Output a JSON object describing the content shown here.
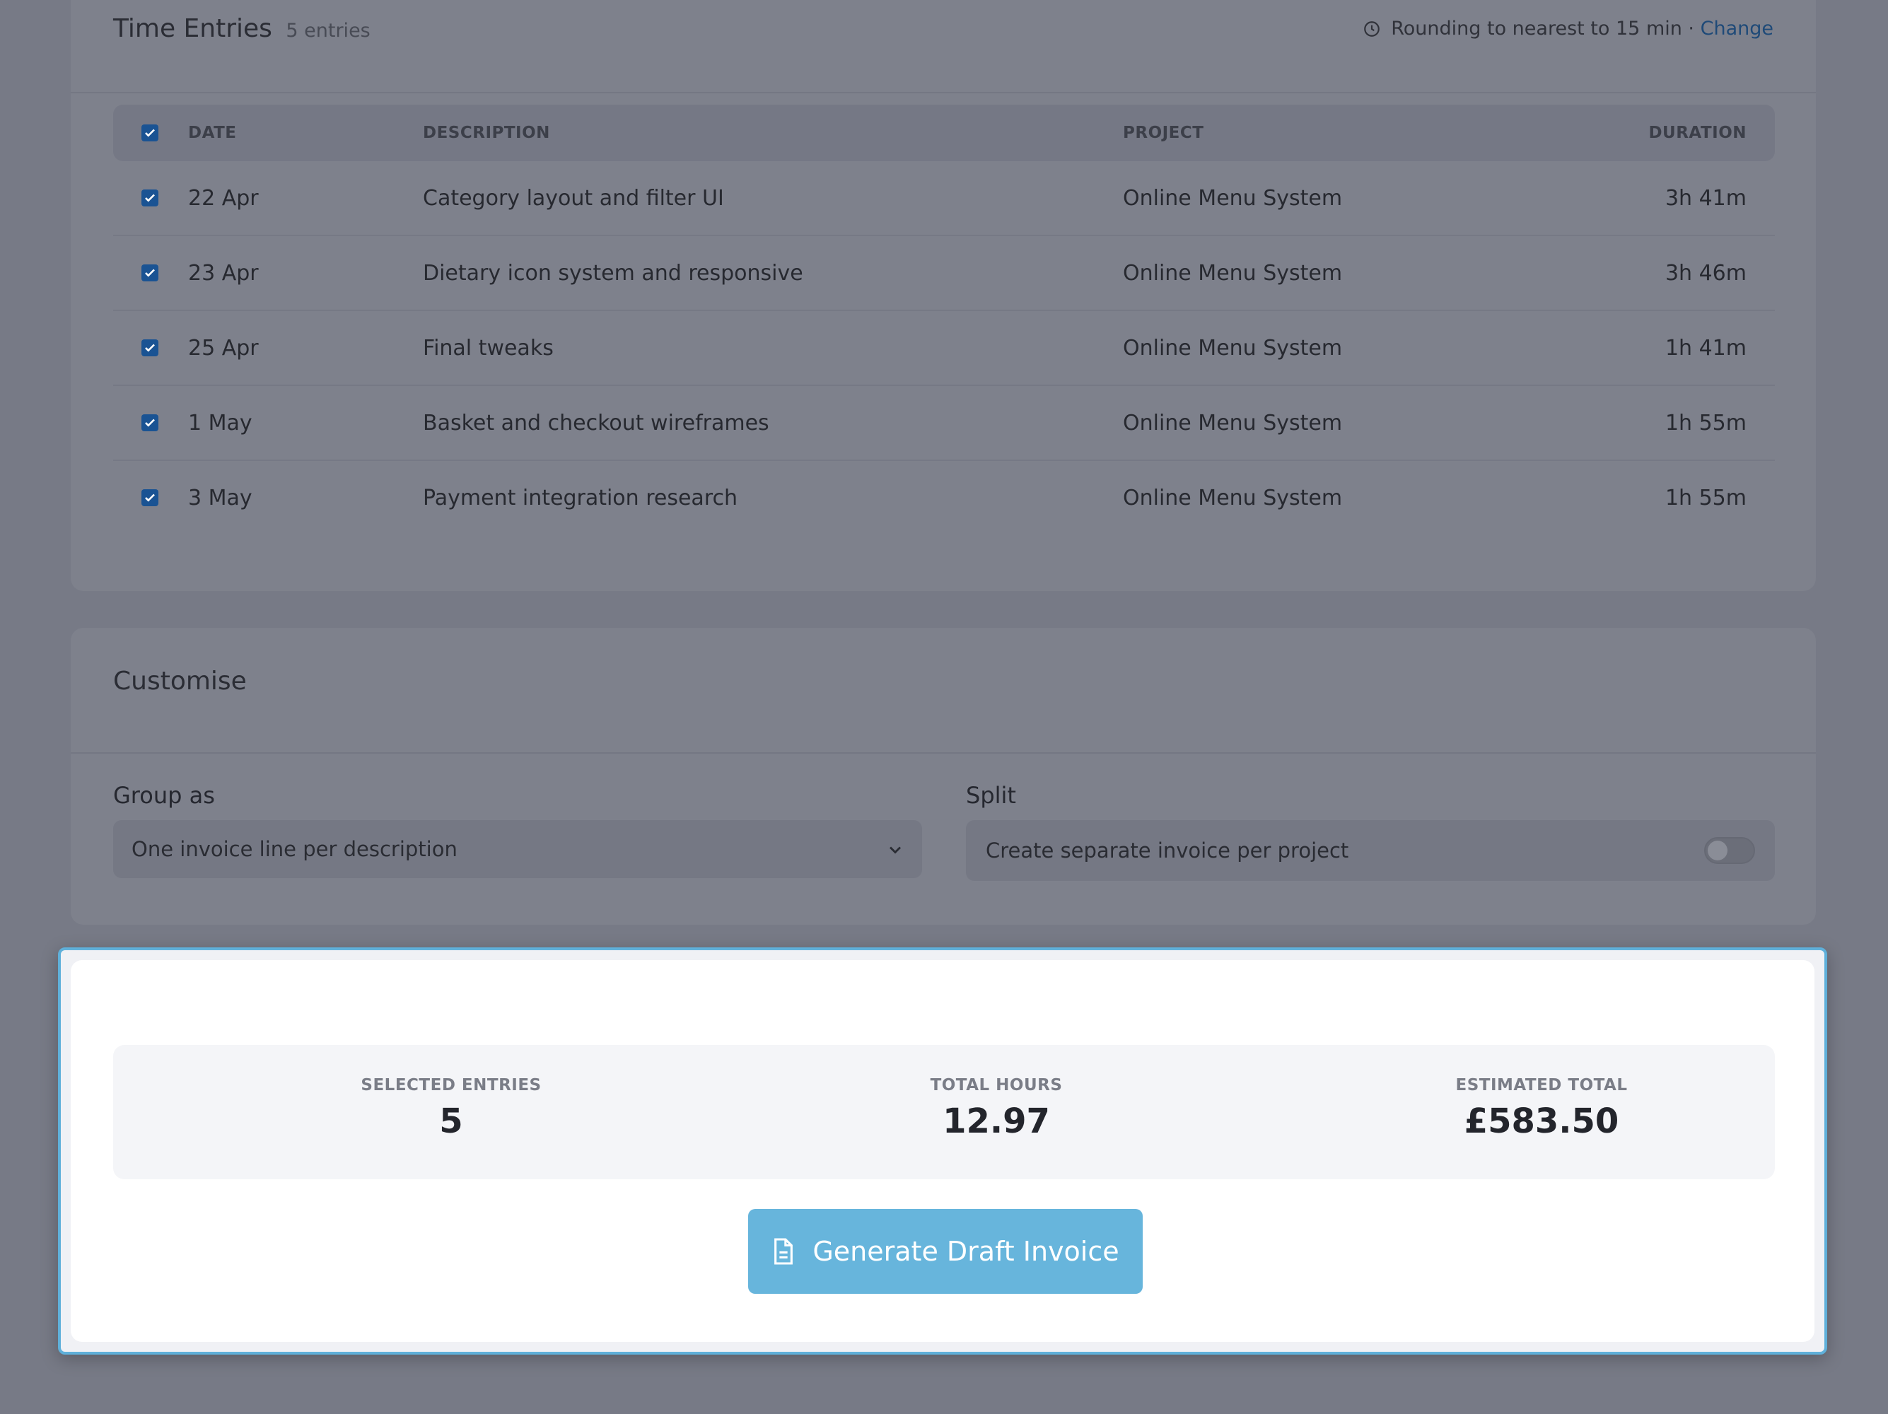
{
  "time_entries": {
    "title": "Time Entries",
    "count_label": "5 entries",
    "rounding_text": "Rounding to nearest to 15 min ·",
    "change_link": "Change",
    "columns": {
      "date": "DATE",
      "description": "DESCRIPTION",
      "project": "PROJECT",
      "duration": "DURATION"
    },
    "rows": [
      {
        "checked": true,
        "date": "22 Apr",
        "description": "Category layout and filter UI",
        "project": "Online Menu System",
        "duration": "3h 41m"
      },
      {
        "checked": true,
        "date": "23 Apr",
        "description": "Dietary icon system and responsive",
        "project": "Online Menu System",
        "duration": "3h 46m"
      },
      {
        "checked": true,
        "date": "25 Apr",
        "description": "Final tweaks",
        "project": "Online Menu System",
        "duration": "1h 41m"
      },
      {
        "checked": true,
        "date": "1 May",
        "description": "Basket and checkout wireframes",
        "project": "Online Menu System",
        "duration": "1h 55m"
      },
      {
        "checked": true,
        "date": "3 May",
        "description": "Payment integration research",
        "project": "Online Menu System",
        "duration": "1h 55m"
      }
    ]
  },
  "customise": {
    "title": "Customise",
    "group_as": {
      "label": "Group as",
      "value": "One invoice line per description"
    },
    "split": {
      "label": "Split",
      "option_label": "Create separate invoice per project",
      "enabled": false
    }
  },
  "summary": {
    "selected_entries": {
      "label": "SELECTED ENTRIES",
      "value": "5"
    },
    "total_hours": {
      "label": "TOTAL HOURS",
      "value": "12.97"
    },
    "estimated_total": {
      "label": "ESTIMATED TOTAL",
      "value": "£583.50"
    },
    "generate_button": "Generate Draft Invoice"
  },
  "colors": {
    "accent": "#67b5dc",
    "highlight_border": "#5fb0da",
    "checkbox": "#1a5393",
    "link": "#1f4a78"
  },
  "icons": {
    "clock": "clock-icon",
    "chevron": "chevron-down-icon",
    "document": "document-icon",
    "check": "check-icon"
  }
}
